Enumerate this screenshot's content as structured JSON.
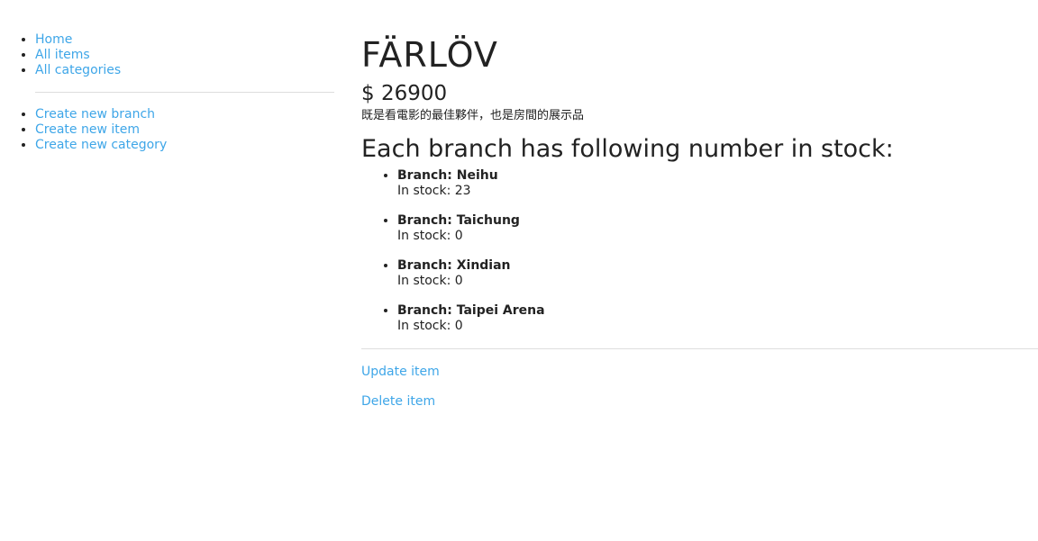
{
  "sidebar": {
    "primary_links": [
      {
        "label": "Home"
      },
      {
        "label": "All items"
      },
      {
        "label": "All categories"
      }
    ],
    "create_links": [
      {
        "label": "Create new branch"
      },
      {
        "label": "Create new item"
      },
      {
        "label": "Create new category"
      }
    ]
  },
  "item": {
    "name": "FÄRLÖV",
    "price": "$ 26900",
    "description": "既是看電影的最佳夥伴，也是房間的展示品"
  },
  "stock": {
    "heading": "Each branch has following number in stock:",
    "branches": [
      {
        "branch": "Branch: Neihu",
        "in_stock": "In stock: 23"
      },
      {
        "branch": "Branch: Taichung",
        "in_stock": "In stock: 0"
      },
      {
        "branch": "Branch: Xindian",
        "in_stock": "In stock: 0"
      },
      {
        "branch": "Branch: Taipei Arena",
        "in_stock": "In stock: 0"
      }
    ]
  },
  "actions": {
    "update_label": "Update item",
    "delete_label": "Delete item"
  },
  "colors": {
    "link": "#3ea6e8",
    "text": "#222222",
    "divider": "#dddddd"
  }
}
